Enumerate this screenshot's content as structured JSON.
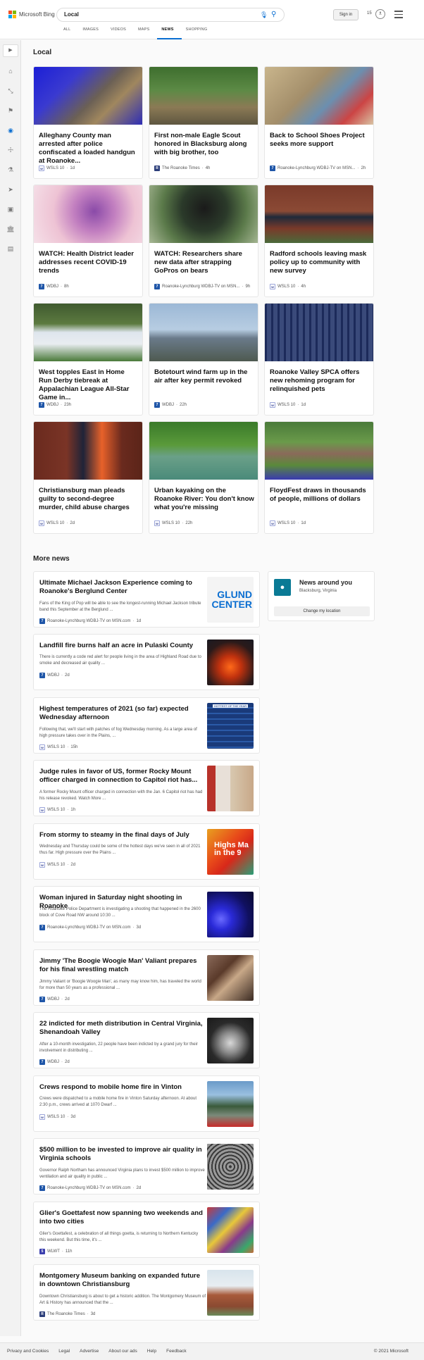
{
  "brand": {
    "logo_text": "Microsoft Bing",
    "logo_colors": [
      "#f25022",
      "#7fba00",
      "#00a4ef",
      "#ffb900"
    ]
  },
  "search": {
    "value": "Local",
    "mic_icon": "microphone-icon",
    "search_icon": "search-icon"
  },
  "header": {
    "sign_in": "Sign in",
    "rewards_count": "15",
    "menu_icon": "hamburger-icon"
  },
  "tabs": [
    {
      "label": "ALL"
    },
    {
      "label": "IMAGES"
    },
    {
      "label": "VIDEOS"
    },
    {
      "label": "MAPS"
    },
    {
      "label": "NEWS"
    },
    {
      "label": "SHOPPING"
    }
  ],
  "active_tab": "NEWS",
  "rail_icons": [
    "expand-icon",
    "home-icon",
    "sports-icon",
    "flag-icon",
    "location-icon",
    "health-icon",
    "science-icon",
    "technology-icon",
    "entertainment-icon",
    "politics-icon",
    "money-icon"
  ],
  "local": {
    "title": "Local",
    "cards": [
      {
        "title": "Alleghany County man arrested after police confiscated a loaded handgun at Roanoke...",
        "source": "WSLS 10",
        "time": "1d"
      },
      {
        "title": "First non-male Eagle Scout honored in Blacksburg along with big brother, too",
        "source": "The Roanoke Times",
        "time": "4h"
      },
      {
        "title": "Back to School Shoes Project seeks more support",
        "source": "Roanoke-Lynchburg WDBJ-TV on MSN...",
        "time": "2h"
      },
      {
        "title": "WATCH: Health District leader addresses recent COVID-19 trends",
        "source": "WDBJ",
        "time": "8h"
      },
      {
        "title": "WATCH: Researchers share new data after strapping GoPros on bears",
        "source": "Roanoke-Lynchburg WDBJ-TV on MSN...",
        "time": "9h"
      },
      {
        "title": "Radford schools leaving mask policy up to community with new survey",
        "source": "WSLS 10",
        "time": "4h"
      },
      {
        "title": "West topples East in Home Run Derby tiebreak at Appalachian League All-Star Game in...",
        "source": "WDBJ",
        "time": "23h"
      },
      {
        "title": "Botetourt wind farm up in the air after key permit revoked",
        "source": "WDBJ",
        "time": "22h"
      },
      {
        "title": "Roanoke Valley SPCA offers new rehoming program for relinquished pets",
        "source": "WSLS 10",
        "time": "1d"
      },
      {
        "title": "Christiansburg man pleads guilty to second-degree murder, child abuse charges",
        "source": "WSLS 10",
        "time": "2d"
      },
      {
        "title": "Urban kayaking on the Roanoke River: You don't know what you're missing",
        "source": "WSLS 10",
        "time": "22h"
      },
      {
        "title": "FloydFest draws in thousands of people, millions of dollars",
        "source": "WSLS 10",
        "time": "1d"
      }
    ]
  },
  "more_news": {
    "title": "More news",
    "items": [
      {
        "title": "Ultimate Michael Jackson Experience coming to Roanoke's Berglund Center",
        "snippet": "Fans of the King of Pop will be able to see the longest-running Michael Jackson tribute band this September at the Berglund ...",
        "source": "Roanoke-Lynchburg WDBJ-TV on MSN.com",
        "time": "1d",
        "thumb_text": "GLUND CENTER"
      },
      {
        "title": "Landfill fire burns half an acre in Pulaski County",
        "snippet": "There is currently a code red alert for people living in the area of Highland Road due to smoke and decreased air quality ...",
        "source": "WDBJ",
        "time": "2d"
      },
      {
        "title": "Highest temperatures of 2021 (so far) expected Wednesday afternoon",
        "snippet": "Following that, we'll start with patches of fog Wednesday morning. As a large area of high pressure takes over in the Plains, ...",
        "source": "WSLS 10",
        "time": "15h",
        "thumb_text": "HOTTEST OF THE YEAR"
      },
      {
        "title": "Judge rules in favor of US, former Rocky Mount officer charged in connection to Capitol riot has...",
        "snippet": "A former Rocky Mount officer charged in connection with the Jan. 6 Capitol riot has had his release revoked. Watch More ...",
        "source": "WSLS 10",
        "time": "1h"
      },
      {
        "title": "From stormy to steamy in the final days of July",
        "snippet": "Wednesday and Thursday could be some of the hottest days we've seen in all of 2021 thus far. High pressure over the Plains ...",
        "source": "WSLS 10",
        "time": "2d",
        "thumb_text": "Highs Ma in the 9"
      },
      {
        "title": "Woman injured in Saturday night shooting in Roanoke",
        "snippet": "The Roanoke Police Department is investigating a shooting that happened in the 2600 block of Cove Road NW around 10:30 ...",
        "source": "Roanoke-Lynchburg WDBJ-TV on MSN.com",
        "time": "3d"
      },
      {
        "title": "Jimmy 'The Boogie Woogie Man' Valiant prepares for his final wrestling match",
        "snippet": "Jimmy Valiant or 'Boogie Woogie Man', as many may know him, has traveled the world for more than 50 years as a professional ...",
        "source": "WDBJ",
        "time": "2d"
      },
      {
        "title": "22 indicted for meth distribution in Central Virginia, Shenandoah Valley",
        "snippet": "After a 10-month investigation, 22 people have been indicted by a grand jury for their involvement in distributing ...",
        "source": "WDBJ",
        "time": "2d"
      },
      {
        "title": "Crews respond to mobile home fire in Vinton",
        "snippet": "Crews were dispatched to a mobile home fire in Vinton Saturday afternoon. At about 2:30 p.m., crews arrived at 1070 Dwarf ...",
        "source": "WSLS 10",
        "time": "3d"
      },
      {
        "title": "$500 million to be invested to improve air quality in Virginia schools",
        "snippet": "Governor Ralph Northam has announced Virginia plans to invest $500 million to improve ventilation and air quality in public ...",
        "source": "Roanoke-Lynchburg WDBJ-TV on MSN.com",
        "time": "2d"
      },
      {
        "title": "Glier's Goettafest now spanning two weekends and into two cities",
        "snippet": "Glier's Goettafest, a celebration of all things goetta, is returning to Northern Kentucky this weekend. But this time, it's ...",
        "source": "WLWT",
        "time": "11h"
      },
      {
        "title": "Montgomery Museum banking on expanded future in downtown Christiansburg",
        "snippet": "Downtown Christiansburg is about to get a historic addition. The Montgomery Museum of Art & History has announced that the ...",
        "source": "The Roanoke Times",
        "time": "3d"
      }
    ]
  },
  "around": {
    "title": "News around you",
    "location": "Blacksburg, Virginia",
    "button": "Change my location"
  },
  "footer": {
    "links": [
      "Privacy and Cookies",
      "Legal",
      "Advertise",
      "About our ads",
      "Help",
      "Feedback"
    ],
    "copyright": "© 2021 Microsoft"
  }
}
